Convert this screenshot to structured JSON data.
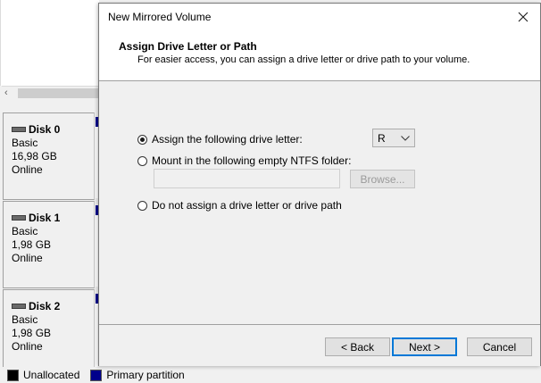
{
  "background": {
    "scroll_left_glyph": "‹",
    "disks": [
      {
        "name": "Disk 0",
        "type": "Basic",
        "size": "16,98 GB",
        "status": "Online"
      },
      {
        "name": "Disk 1",
        "type": "Basic",
        "size": "1,98 GB",
        "status": "Online"
      },
      {
        "name": "Disk 2",
        "type": "Basic",
        "size": "1,98 GB",
        "status": "Online"
      }
    ],
    "legend": [
      {
        "label": "Unallocated",
        "color": "#000000"
      },
      {
        "label": "Primary partition",
        "color": "#00008b"
      }
    ]
  },
  "dialog": {
    "title": "New Mirrored Volume",
    "header_title": "Assign Drive Letter or Path",
    "header_subtitle": "For easier access, you can assign a drive letter or drive path to your volume.",
    "options": {
      "assign_letter": {
        "label": "Assign the following drive letter:",
        "checked": true
      },
      "mount_folder": {
        "label": "Mount in the following empty NTFS folder:",
        "checked": false
      },
      "no_assign": {
        "label": "Do not assign a drive letter or drive path",
        "checked": false
      }
    },
    "drive_letter": {
      "selected": "R"
    },
    "folder_path": {
      "value": "",
      "placeholder": ""
    },
    "browse_label": "Browse...",
    "buttons": {
      "back": "< Back",
      "next": "Next >",
      "cancel": "Cancel"
    },
    "accent_color": "#0078d7"
  }
}
